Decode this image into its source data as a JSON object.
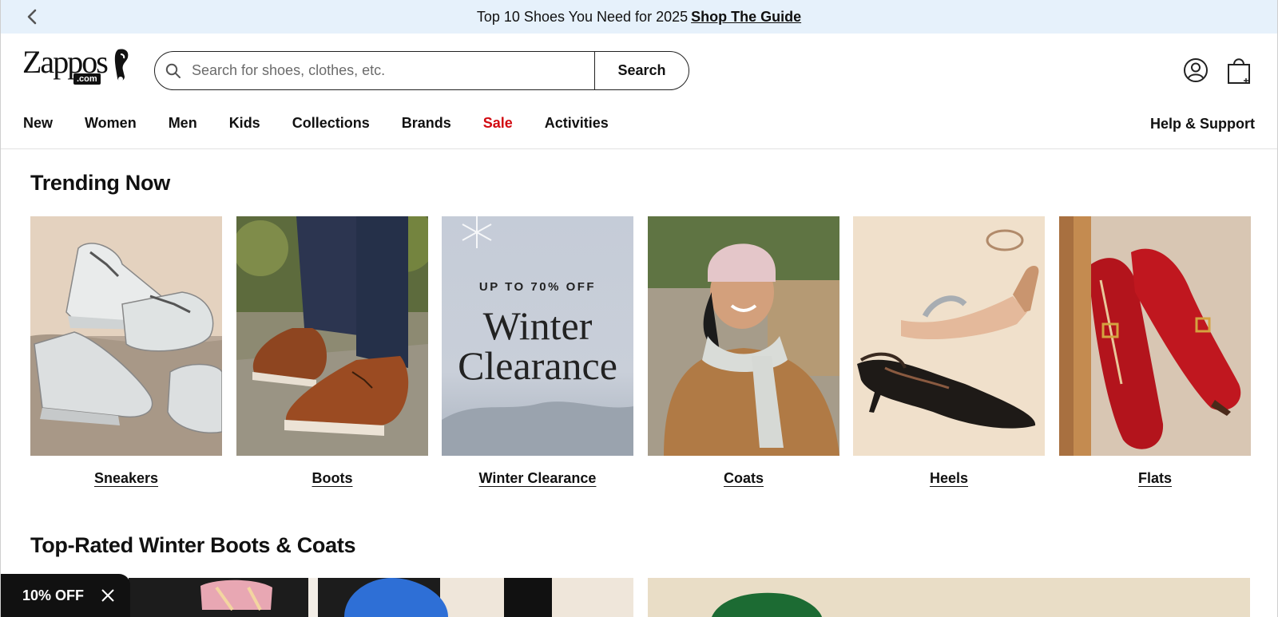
{
  "promo": {
    "text": "Top 10 Shoes You Need for 2025",
    "link": "Shop The Guide"
  },
  "header": {
    "logo_word": "Zappos",
    "logo_suffix": ".com",
    "search_placeholder": "Search for shoes, clothes, etc.",
    "search_button": "Search"
  },
  "nav": {
    "items": [
      "New",
      "Women",
      "Men",
      "Kids",
      "Collections",
      "Brands",
      "Sale",
      "Activities"
    ],
    "help": "Help & Support"
  },
  "trending": {
    "title": "Trending Now",
    "tiles": [
      {
        "label": "Sneakers"
      },
      {
        "label": "Boots"
      },
      {
        "label": "Winter Clearance",
        "kicker": "UP TO 70% OFF",
        "headline_1": "Winter",
        "headline_2": "Clearance"
      },
      {
        "label": "Coats"
      },
      {
        "label": "Heels"
      },
      {
        "label": "Flats"
      }
    ]
  },
  "toprated": {
    "title": "Top-Rated Winter Boots & Coats"
  },
  "offer": {
    "label": "10% OFF"
  },
  "colors": {
    "promo_bg": "#e6f1fb",
    "sale_red": "#d20a11",
    "offer_bg": "#111111"
  }
}
